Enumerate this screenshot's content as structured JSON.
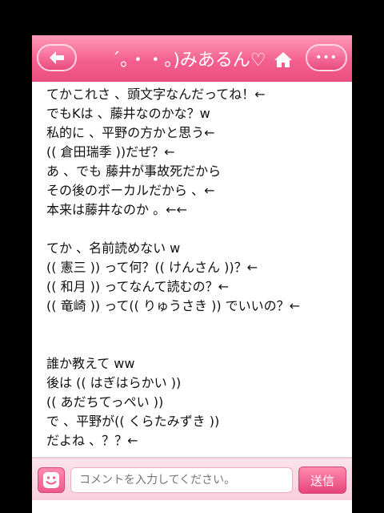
{
  "header": {
    "title": "´｡・・｡)みあるん♡",
    "back_icon": "arrow-left-icon",
    "home_icon": "home-icon",
    "more_label": "•••"
  },
  "post": {
    "lines": [
      "てかこれさ 、頭文字なんだってね！←",
      "でもKは 、藤井なのかな？w",
      "私的に 、平野の方かと思う←",
      "(( 倉田瑞季 ))だぜ？←",
      "あ 、でも 藤井が事故死だから",
      "その後のボーカルだから 、←",
      "本来は藤井なのか 。←←",
      "",
      "てか 、名前読めない w",
      "(( 憲三 )) って何？(( けんさん ))？←",
      "(( 和月 )) ってなんて読むの？←",
      "(( 竜崎 )) って(( りゅうさき )) でいいの？←",
      "",
      "",
      "誰か教えて ww",
      "後は (( はぎはらかい ))",
      "(( あだちてっぺい ))",
      "で 、平野が(( くらたみずき ))",
      "だよね 、？？←"
    ]
  },
  "footer": {
    "comment_placeholder": "コメントを入力してください。",
    "send_label": "送信",
    "emoji_icon": "smiley-icon"
  }
}
